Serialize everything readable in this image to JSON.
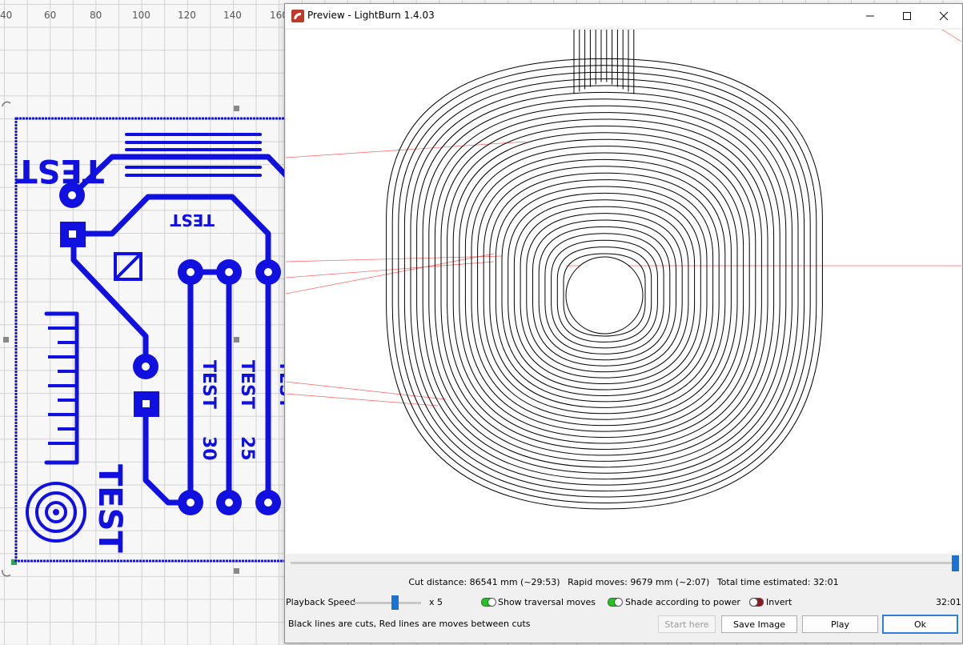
{
  "workspace": {
    "ruler_labels": [
      "40",
      "60",
      "80",
      "100",
      "120",
      "140",
      "160"
    ],
    "design_texts": [
      "TEST",
      "TEST",
      "TEST",
      "TEST",
      "TEST",
      "30",
      "25"
    ],
    "design_color": "#1010e0"
  },
  "preview": {
    "title": "Preview - LightBurn 1.4.03",
    "window_buttons": {
      "minimize": "minimize-icon",
      "maximize": "maximize-icon",
      "close": "close-icon"
    },
    "stats": {
      "cut_distance": "Cut distance: 86541 mm (~29:53)",
      "rapid_moves": "Rapid moves: 9679 mm (~2:07)",
      "total_time": "Total time estimated: 32:01"
    },
    "controls": {
      "playback_speed_label": "Playback Speed",
      "speed_value": "x 5",
      "show_traversal": "Show traversal moves",
      "shade_power": "Shade according to power",
      "invert": "Invert",
      "time": "32:01",
      "show_traversal_on": true,
      "shade_power_on": true,
      "invert_on": false
    },
    "legend_text": "Black lines are cuts, Red lines are moves between cuts",
    "buttons": {
      "start_here": "Start here",
      "save_image": "Save Image",
      "play": "Play",
      "ok": "Ok"
    },
    "colors": {
      "accent": "#1a73d1",
      "toggle_on": "#21c421",
      "toggle_off": "#8b1a1a",
      "traversal": "#ff6060"
    }
  }
}
